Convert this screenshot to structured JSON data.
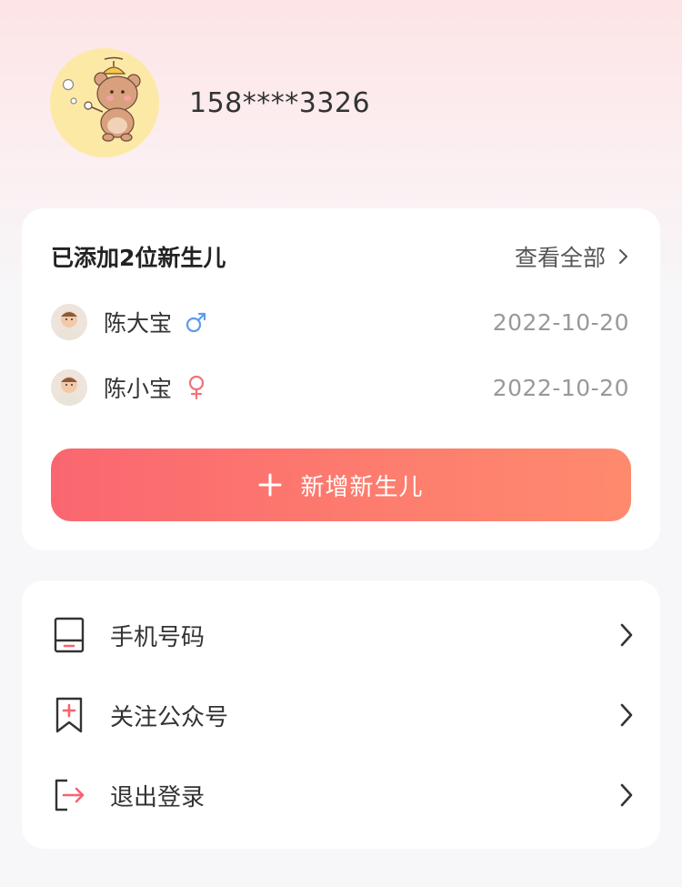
{
  "profile": {
    "phone": "158****3326"
  },
  "babies": {
    "title": "已添加2位新生儿",
    "view_all": "查看全部",
    "items": [
      {
        "name": "陈大宝",
        "gender": "male",
        "gender_color": "#5b9bf0",
        "date": "2022-10-20"
      },
      {
        "name": "陈小宝",
        "gender": "female",
        "gender_color": "#f2727a",
        "date": "2022-10-20"
      }
    ],
    "add_label": "新增新生儿"
  },
  "menu": [
    {
      "label": "手机号码",
      "icon": "phone-icon"
    },
    {
      "label": "关注公众号",
      "icon": "bookmark-plus-icon"
    },
    {
      "label": "退出登录",
      "icon": "logout-icon"
    }
  ],
  "colors": {
    "accent": "#f8616f",
    "accent_end": "#fe8a6e",
    "male": "#5b9bf0",
    "female": "#f2727a"
  }
}
